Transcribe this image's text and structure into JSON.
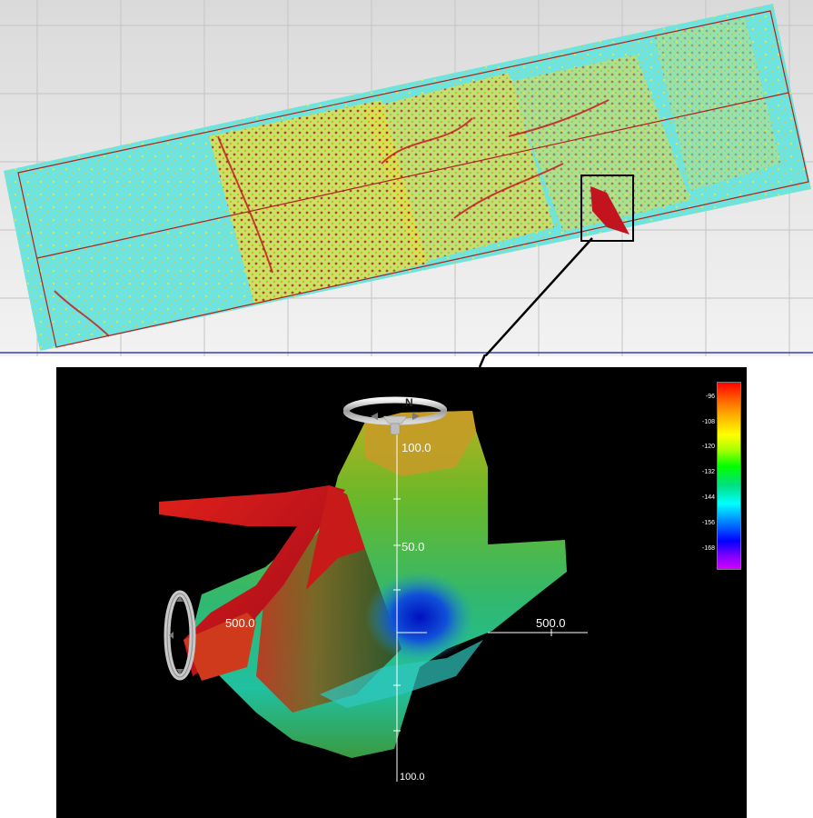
{
  "top_view": {
    "description_hidden": ""
  },
  "detail_view": {
    "compass": {
      "north_label": "N"
    },
    "axis_labels": {
      "vertical_top": "100.0",
      "vertical_mid": "50.0",
      "vertical_bottom": "100.0",
      "horizontal_left": "500.0",
      "horizontal_right": "500.0"
    },
    "legend": {
      "ticks": [
        "-96",
        "-108",
        "-120",
        "-132",
        "-144",
        "-156",
        "-168"
      ],
      "colors": [
        "#ff0000",
        "#ffaa00",
        "#ffff00",
        "#00ff00",
        "#00ffff",
        "#0000ff",
        "#d000ff"
      ]
    }
  },
  "colors": {
    "grid_line": "#c4c4c4",
    "swath_base": "#6fe3dd",
    "highlight_red": "#c3131f",
    "detail_background": "#000000"
  }
}
